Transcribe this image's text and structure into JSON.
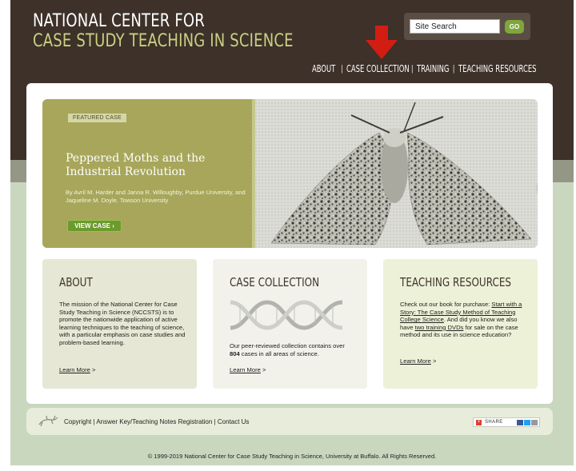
{
  "logo": {
    "line1": "NATIONAL CENTER FOR",
    "line2": "CASE STUDY TEACHING IN SCIENCE"
  },
  "search": {
    "placeholder": "Site Search",
    "value": "Site Search",
    "button_label": "GO"
  },
  "nav": [
    {
      "label": "ABOUT"
    },
    {
      "label": "CASE COLLECTION"
    },
    {
      "label": "TRAINING"
    },
    {
      "label": "TEACHING RESOURCES"
    }
  ],
  "featured": {
    "badge": "FEATURED CASE",
    "title": "Peppered Moths and the Industrial Revolution",
    "authors": "By Avril M. Harder and Janna R. Willoughby, Purdue University, and Jaqueline M. Doyle, Towson University",
    "button_label": "VIEW CASE"
  },
  "boxes": {
    "about": {
      "heading": "ABOUT",
      "text": "The mission of the National Center for Case Study Teaching in Science (NCCSTS) is to promote the nationwide application of active learning techniques to the teaching of science, with a particular emphasis on case studies and problem-based learning.",
      "link": "Learn More"
    },
    "collection": {
      "heading": "CASE COLLECTION",
      "text_before": "Our peer-reviewed collection contains over ",
      "count": "804",
      "text_after": " cases in all areas of science.",
      "link": "Learn More"
    },
    "resources": {
      "heading": "TEACHING RESOURCES",
      "text1": "Check out our book for purchase: ",
      "book_link": "Start with a Story: The Case Study Method of Teaching College Science",
      "text2": ". And did you know we also have ",
      "dvd_link": "two training DVDs",
      "text3": " for sale on the case method and its use in science education?",
      "link": "Learn More"
    }
  },
  "footer": {
    "links": [
      "Copyright",
      "Answer Key/Teaching Notes Registration",
      "Contact Us"
    ],
    "share_label": "SHARE",
    "copyright": "© 1999-2019 National Center for Case Study Teaching in Science, University at Buffalo. All Rights Reserved."
  },
  "colors": {
    "header_bg": "#3d3129",
    "accent_green": "#7fa63a",
    "featured_bg": "#a7a65a",
    "page_bg": "#c9d7bf",
    "arrow_red": "#d21d12"
  },
  "icons": [
    "red-arrow-annotation-icon",
    "chevron-right-icon",
    "dna-icon",
    "lizard-icon",
    "share-icon"
  ]
}
